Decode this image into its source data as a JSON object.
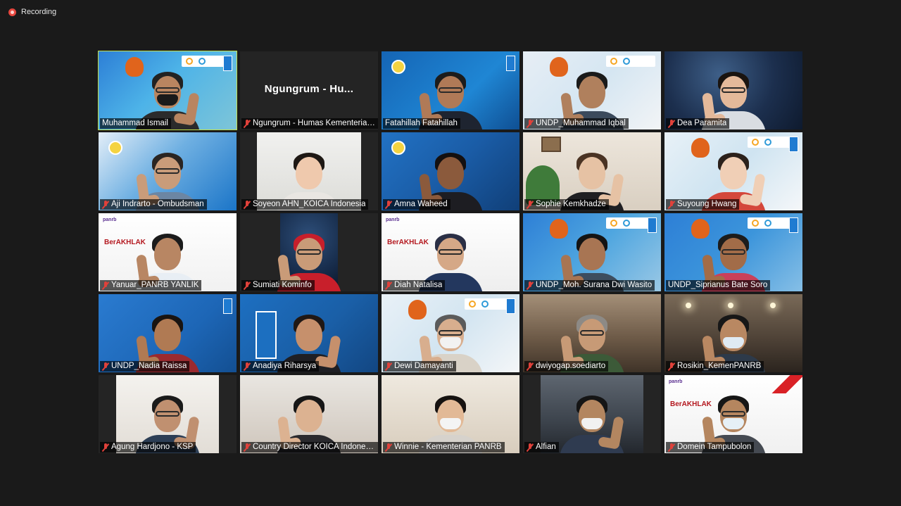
{
  "recording": {
    "label": "Recording"
  },
  "participants": [
    {
      "name": "Muhammad Ismail",
      "muted": false,
      "active": true,
      "bg": "linear-gradient(135deg,#2d7fd6 0%,#4db3e8 45%,#7ec5d8 100%)",
      "skin": "#b98560",
      "hair": "#222222",
      "cloth": "#2b2b2b",
      "mask": true,
      "maskc": "#1a1a1a",
      "glasses": true,
      "hands": "r",
      "deco": [
        "goal",
        "orangutan",
        "undp"
      ]
    },
    {
      "name": "Ngungrum - Humas Kementerian PANRB",
      "display": "Ngungrum - Hu...",
      "muted": true,
      "video": false
    },
    {
      "name": "Fatahillah Fatahillah",
      "muted": false,
      "bg": "linear-gradient(135deg,#1565b5 0%,#1f86d4 60%,#0f4f93 100%)",
      "skin": "#b07a57",
      "hair": "#1c1c1c",
      "cloth": "#1e2430",
      "glasses": true,
      "hands": "l",
      "deco": [
        "ring",
        "undp"
      ]
    },
    {
      "name": "UNDP_Muhammad Iqbal",
      "muted": true,
      "bg": "linear-gradient(135deg,#e7eef5 0%,#d5e6f2 50%,#f2f4f6 100%)",
      "skin": "#b0805d",
      "hair": "#1a1a1a",
      "cloth": "#3b4a5c",
      "hands": "l",
      "deco": [
        "goal",
        "orangutan"
      ]
    },
    {
      "name": "Dea Paramita",
      "muted": true,
      "bg": "radial-gradient(circle at 40% 30%,#3e5f88 0%,#1c2f4e 55%,#0e1a2e 100%)",
      "skin": "#e4b99a",
      "hair": "#1a1410",
      "cloth": "#d9dde2",
      "glasses": true,
      "hands": "l"
    },
    {
      "name": "Aji Indrarto - Ombudsman",
      "muted": true,
      "bg": "linear-gradient(135deg,#e3eef8 0%,#6fb0e2 45%,#1b75c8 100%)",
      "skin": "#c99c7a",
      "hair": "#2a2522",
      "cloth": "#6c86a3",
      "glasses": true,
      "hands": "l",
      "deco": [
        "ring"
      ]
    },
    {
      "name": "Soyeon AHN_KOICA Indonesia",
      "muted": true,
      "bg": "linear-gradient(180deg,#f1f1ef 0%,#dcdcd8 100%)",
      "skin": "#efc9ad",
      "hair": "#1e1814",
      "cloth": "#e9e6e2",
      "hands": "none",
      "insetL": "12%",
      "insetR": "12%"
    },
    {
      "name": "Amna Waheed",
      "muted": true,
      "bg": "linear-gradient(135deg,#2272c4 0%,#1a5ca6 50%,#103f78 100%)",
      "skin": "#8b5a3c",
      "hair": "#141010",
      "cloth": "#1d1d22",
      "hands": "l",
      "deco": [
        "ring"
      ]
    },
    {
      "name": "Sophie Kemkhadze",
      "muted": true,
      "bg": "linear-gradient(180deg,#ede6dc 0%,#d9cfc1 100%)",
      "skin": "#e6c2a4",
      "hair": "#4a3323",
      "cloth": "#1f1f22",
      "hands": "r",
      "deco": [
        "plant",
        "frame"
      ]
    },
    {
      "name": "Suyoung Hwang",
      "muted": true,
      "bg": "linear-gradient(135deg,#e8f1f7 0%,#cfe4f1 50%,#f5f7f9 100%)",
      "skin": "#f0cfb6",
      "hair": "#2b211b",
      "cloth": "#d4473b",
      "hands": "r",
      "deco": [
        "goal",
        "orangutan",
        "undp"
      ]
    },
    {
      "name": "Yanuar_PANRB YANLIK",
      "muted": true,
      "bg": "linear-gradient(180deg,#ffffff 0%,#f1f1f1 100%)",
      "skin": "#b88663",
      "hair": "#1b1b1b",
      "cloth": "#e8eef4",
      "hands": "l",
      "deco": [
        "brand"
      ]
    },
    {
      "name": "Sumiati Kominfo",
      "muted": true,
      "bg": "radial-gradient(circle at 50% 30%,#2e4f7a 0%,#172c4b 60%,#0b1628 100%)",
      "skin": "#c99b78",
      "hair": "#c81f2b",
      "cloth": "#c81f2b",
      "glasses": true,
      "hands": "l",
      "insetL": "29%",
      "insetR": "29%"
    },
    {
      "name": "Diah Natalisa",
      "muted": true,
      "bg": "linear-gradient(180deg,#ffffff 0%,#eeeeee 100%)",
      "skin": "#d5a887",
      "hair": "#2a2f45",
      "cloth": "#23375e",
      "glasses": true,
      "hands": "none",
      "deco": [
        "brand"
      ]
    },
    {
      "name": "UNDP_Moh. Surana Dwi Wasito",
      "display": "UNDP_Moh. Surana Dwi Wasi...",
      "muted": true,
      "bg": "linear-gradient(135deg,#2d7fd6 0%,#4fa6e0 50%,#9ac8e5 100%)",
      "skin": "#a87553",
      "hair": "#141414",
      "cloth": "#3d4d5e",
      "hands": "l",
      "deco": [
        "goal",
        "orangutan",
        "undp"
      ]
    },
    {
      "name": "UNDP_Siprianus Bate Soro",
      "muted": false,
      "bg": "linear-gradient(135deg,#2d7fd6 0%,#3c95db 50%,#86bfe6 100%)",
      "skin": "#a26c48",
      "hair": "#1c1c1c",
      "cloth": "#c9405a",
      "glasses": true,
      "hands": "l",
      "deco": [
        "goal",
        "orangutan",
        "undp"
      ]
    },
    {
      "name": "UNDP_Nadia Raissa",
      "muted": true,
      "bg": "linear-gradient(135deg,#2a7bd0 0%,#1d66b6 60%,#134f92 100%)",
      "skin": "#b07a53",
      "hair": "#191411",
      "cloth": "#9b2a2f",
      "hands": "l",
      "deco": [
        "undp"
      ]
    },
    {
      "name": "Anadiya Riharsya",
      "muted": true,
      "bg": "linear-gradient(135deg,#1d6fc1 0%,#1a5fa7 55%,#124682 100%)",
      "skin": "#c6906c",
      "hair": "#201815",
      "cloth": "#1f1f24",
      "hands": "r",
      "deco": [
        "un"
      ]
    },
    {
      "name": "Dewi Damayanti",
      "muted": true,
      "bg": "linear-gradient(135deg,#e9f1f7 0%,#d3e5f1 50%,#f4f6f8 100%)",
      "skin": "#d8ae8e",
      "hair": "#5b5b5b",
      "cloth": "#d9d2c7",
      "mask": true,
      "maskc": "#f2f2f2",
      "glasses": true,
      "hands": "l",
      "deco": [
        "goal",
        "orangutan",
        "undp"
      ]
    },
    {
      "name": "dwiyogap.soediarto",
      "muted": true,
      "bg": "linear-gradient(180deg,#a48f78 0%,#6e5b48 55%,#3f3328 100%)",
      "skin": "#c79a76",
      "hair": "#8d8a86",
      "cloth": "#3c5a38",
      "glasses": true,
      "hands": "l"
    },
    {
      "name": "Rosikin_KemenPANRB",
      "muted": true,
      "bg": "linear-gradient(180deg,#7a6a58 0%,#4c4035 60%,#2b241e 100%)",
      "skin": "#b98862",
      "hair": "#171717",
      "cloth": "#2d3a4a",
      "mask": true,
      "maskc": "#dfeaf3",
      "hands": "l",
      "deco": [
        "lights"
      ]
    },
    {
      "name": "Agung Hardjono - KSP",
      "muted": true,
      "bg": "linear-gradient(180deg,#f4f2ee 0%,#e2ddd6 100%)",
      "skin": "#c09070",
      "hair": "#1a1a1a",
      "cloth": "#2c3e55",
      "glasses": true,
      "hands": "r",
      "insetL": "13%",
      "insetR": "13%"
    },
    {
      "name": "Country Director KOICA Indonesia",
      "display": "Country Director KOICA Indon...",
      "muted": true,
      "bg": "linear-gradient(180deg,#e9e6e1 0%,#cfc6bc 100%)",
      "skin": "#dcb291",
      "hair": "#161616",
      "cloth": "#2a2a2e",
      "hands": "l"
    },
    {
      "name": "Winnie - Kementerian PANRB",
      "muted": true,
      "bg": "linear-gradient(180deg,#efe9df 0%,#d8cdbd 100%)",
      "skin": "#e2b996",
      "hair": "#161210",
      "cloth": "#d6d2cc",
      "mask": true,
      "maskc": "#f4f4f4",
      "hands": "none"
    },
    {
      "name": "Alfian",
      "muted": true,
      "bg": "linear-gradient(180deg,#5e6670 0%,#3c434c 60%,#23272d 100%)",
      "skin": "#b38660",
      "hair": "#151515",
      "cloth": "#2f3b50",
      "mask": true,
      "maskc": "#f1f1f1",
      "hands": "r",
      "insetL": "13%",
      "insetR": "13%"
    },
    {
      "name": "Domein Tampubolon",
      "muted": true,
      "bg": "linear-gradient(180deg,#ffffff 0%,#f0f0f0 100%)",
      "skin": "#b5865f",
      "hair": "#161616",
      "cloth": "#454a52",
      "mask": true,
      "maskc": "#e6f0f6",
      "glasses": true,
      "hands": "l",
      "deco": [
        "brand",
        "redcorner"
      ]
    }
  ],
  "brand": {
    "top": "panrb",
    "word": "BerAKHLAK"
  }
}
